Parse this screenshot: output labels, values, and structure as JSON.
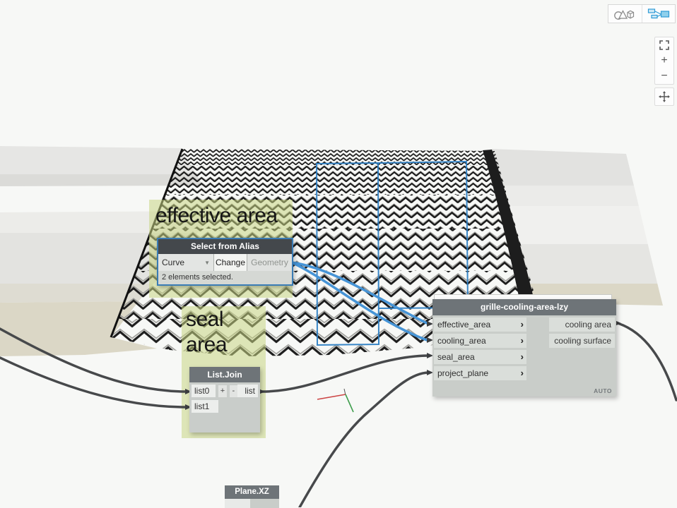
{
  "toolbar": {
    "geometry_view_button": "geometry-view",
    "graph_view_button": "graph-view-active"
  },
  "zoom_controls": {
    "zoom_in": "+",
    "zoom_out": "−"
  },
  "groups": [
    {
      "label": "effective area"
    },
    {
      "label": "seal area"
    }
  ],
  "nodes": {
    "select_from_alias": {
      "title": "Select from Alias",
      "dropdown_value": "Curve",
      "change_label": "Change",
      "geometry_label": "Geometry",
      "status": "2 elements selected."
    },
    "list_join": {
      "title": "List.Join",
      "inputs": [
        "list0",
        "list1"
      ],
      "add_label": "+",
      "remove_label": "-",
      "output": "list"
    },
    "grille": {
      "title": "grille-cooling-area-lzy",
      "inputs": [
        "effective_area",
        "cooling_area",
        "seal_area",
        "project_plane"
      ],
      "outputs": [
        "cooling area",
        "cooling surface"
      ],
      "lacing": "AUTO"
    },
    "plane_xz": {
      "title": "Plane.XZ"
    }
  },
  "colors": {
    "group_fill": "#cbd584",
    "selected_node_border": "#3a7cb5",
    "selection_blue": "#2d7fc4",
    "wire_dark": "#47494b",
    "wire_blue": "#4694d6",
    "node_header": "#6e7478",
    "selected_header": "#44484c",
    "axis_x_red": "#cc4444",
    "axis_z_green": "#3f9e4d"
  }
}
